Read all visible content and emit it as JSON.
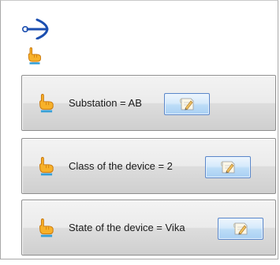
{
  "toolbar": {
    "back_icon": "arrow-right-icon",
    "pointer_icon": "pointing-hand-icon"
  },
  "conditions": [
    {
      "label": "Substation = AB",
      "icon": "pointing-hand-icon",
      "edit_icon": "edit-note-icon"
    },
    {
      "label": "Class of the device = 2",
      "icon": "pointing-hand-icon",
      "edit_icon": "edit-note-icon"
    },
    {
      "label": "State of the device = Vika",
      "icon": "pointing-hand-icon",
      "edit_icon": "edit-note-icon"
    }
  ],
  "colors": {
    "arrow": "#1c4fb0",
    "hand": "#f3a41c",
    "button_border": "#5b87c9",
    "button_fill": "#bcdcf7"
  }
}
